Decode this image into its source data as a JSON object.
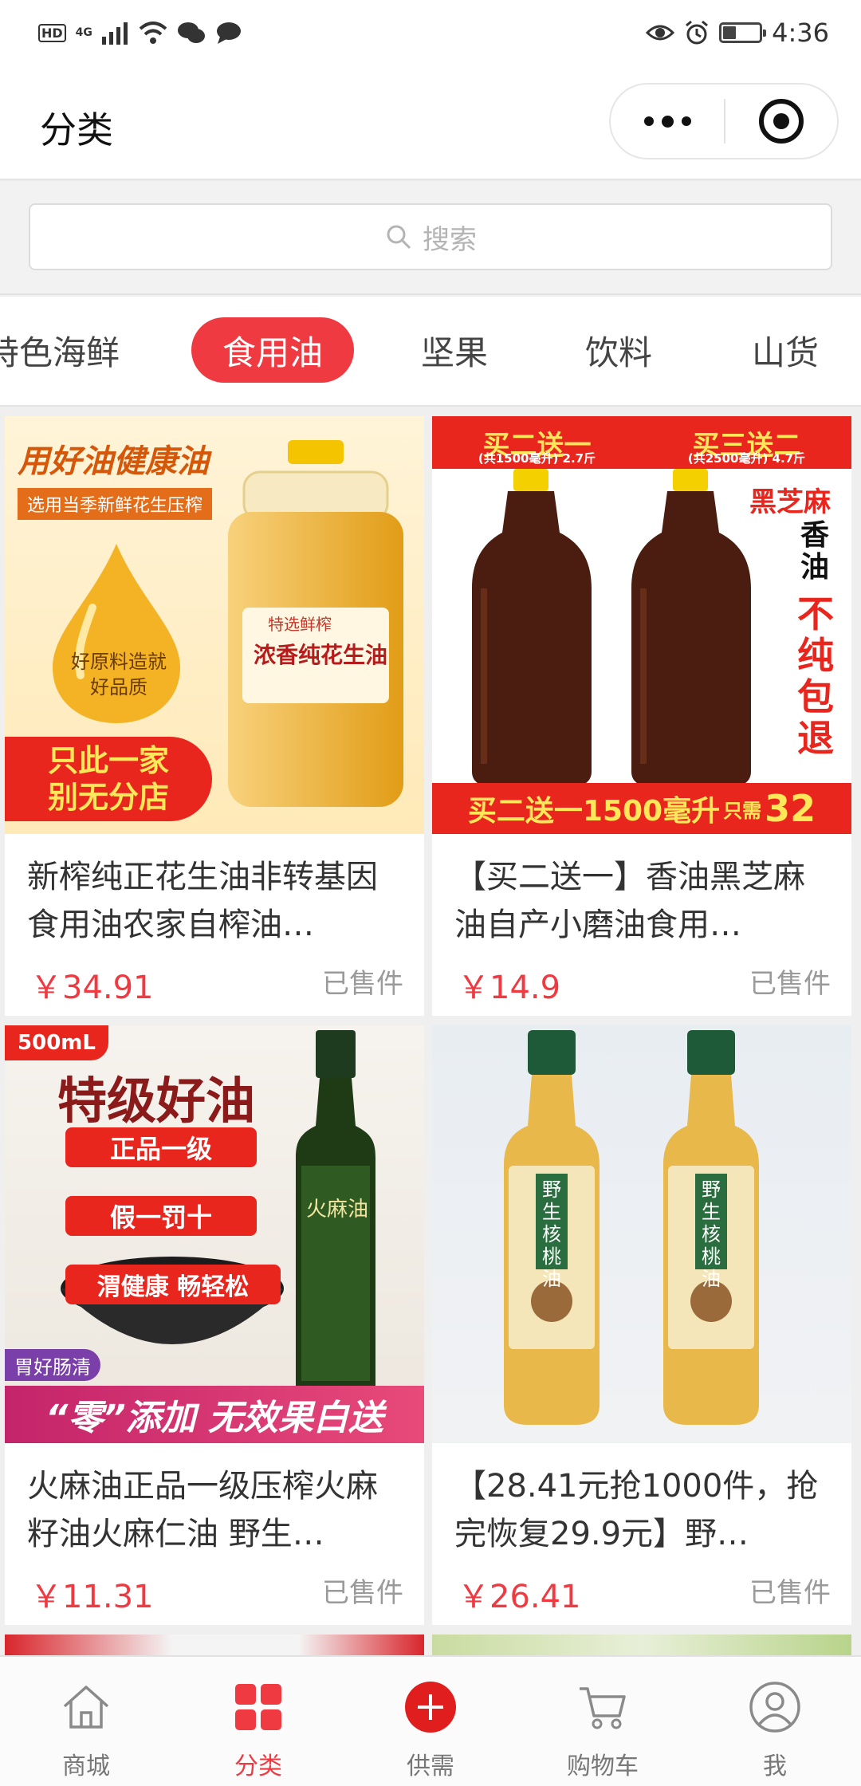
{
  "status_bar": {
    "left_badge": "HD",
    "network": "4G",
    "time": "4:36",
    "battery_level": 0.35
  },
  "header": {
    "title": "分类"
  },
  "search": {
    "placeholder": "搜索"
  },
  "categories": {
    "items": [
      "特色海鲜",
      "食用油",
      "坚果",
      "饮料",
      "山货"
    ],
    "active": "食用油"
  },
  "products": [
    {
      "title": "新榨纯正花生油非转基因食用油农家自榨油…",
      "price": "￥34.91",
      "sold": "已售件",
      "image": {
        "headline": "用好油健康油",
        "subline": "选用当季新鲜花生压榨",
        "drop_text_1": "好原料造就",
        "drop_text_2": "好品质",
        "label_brand": "特选鲜榨",
        "label_name": "浓香纯花生油",
        "bottom_1": "只此一家",
        "bottom_2": "别无分店"
      }
    },
    {
      "title": "【买二送一】香油黑芝麻油自产小磨油食用…",
      "price": "￥14.9",
      "sold": "已售件",
      "image": {
        "promo_left": "买二送一",
        "promo_left_sub": "(共1500毫升) 2.7斤",
        "promo_right": "买三送二",
        "promo_right_sub": "(共2500毫升) 4.7斤",
        "side_1": "黑芝麻",
        "side_2": "香",
        "side_3": "油",
        "side_4": "不",
        "side_5": "纯",
        "side_6": "包",
        "side_7": "退",
        "bottom_main": "买二送一1500毫升",
        "bottom_small": "只需",
        "bottom_price": "32"
      }
    },
    {
      "title": "火麻油正品一级压榨火麻籽油火麻仁油 野生…",
      "price": "￥11.31",
      "sold": "已售件",
      "image": {
        "corner": "500mL",
        "headline": "特级好油",
        "tag_1": "正品一级",
        "tag_2": "假一罚十",
        "tag_3": "渭健康 畅轻松",
        "tag_4": "胃好肠清",
        "bottle_label": "火麻油",
        "bottom": "“零”添加 无效果白送"
      }
    },
    {
      "title": "【28.41元抢1000件，抢完恢复29.9元】野…",
      "price": "￥26.41",
      "sold": "已售件",
      "image": {
        "bottle_label": "野生核桃油"
      }
    }
  ],
  "bottom_nav": [
    {
      "label": "商城",
      "icon": "home-icon",
      "active": false
    },
    {
      "label": "分类",
      "icon": "category-grid-icon",
      "active": true
    },
    {
      "label": "供需",
      "icon": "plus-circle-icon",
      "active": false
    },
    {
      "label": "购物车",
      "icon": "cart-icon",
      "active": false
    },
    {
      "label": "我",
      "icon": "profile-icon",
      "active": false
    }
  ],
  "colors": {
    "accent": "#ef3a41",
    "text": "#333333",
    "muted": "#9a9a9a"
  }
}
